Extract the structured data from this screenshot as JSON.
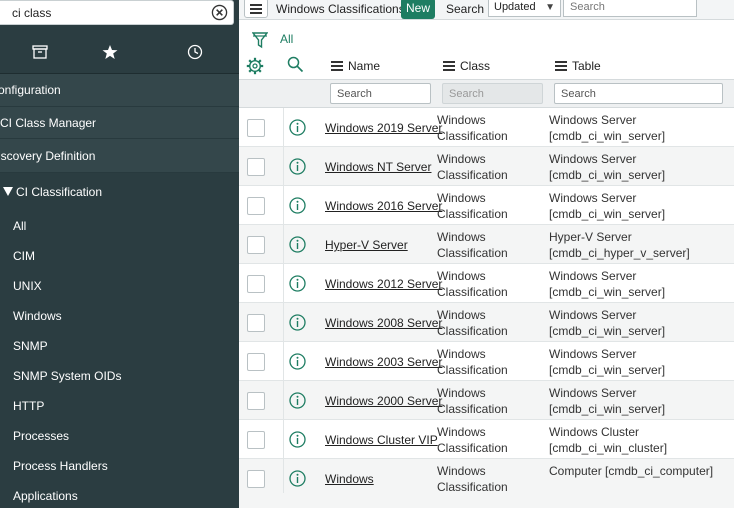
{
  "sidebar": {
    "filter_value": "ci class",
    "tabs": [
      {
        "icon": "archive-icon"
      },
      {
        "icon": "star-icon"
      },
      {
        "icon": "clock-icon"
      }
    ],
    "modules": [
      "onfiguration",
      "CI Class Manager",
      "iscovery Definition"
    ],
    "section": {
      "label": "CI Classification",
      "expanded": true
    },
    "items": [
      "All",
      "CIM",
      "UNIX",
      "Windows",
      "SNMP",
      "SNMP System OIDs",
      "HTTP",
      "Processes",
      "Process Handlers",
      "Applications"
    ]
  },
  "header": {
    "title": "Windows Classifications",
    "new_label": "New",
    "search_label": "Search",
    "sort_value": "Updated",
    "search_placeholder": "Search"
  },
  "filter": {
    "label": "All"
  },
  "columns": [
    "Name",
    "Class",
    "Table"
  ],
  "column_search_placeholders": [
    "Search",
    "Search",
    "Search"
  ],
  "rows": [
    {
      "name": "Windows 2019 Server",
      "class": "Windows Classification",
      "table": "Windows Server [cmdb_ci_win_server]"
    },
    {
      "name": "Windows NT Server",
      "class": "Windows Classification",
      "table": "Windows Server [cmdb_ci_win_server]"
    },
    {
      "name": "Windows 2016 Server",
      "class": "Windows Classification",
      "table": "Windows Server [cmdb_ci_win_server]"
    },
    {
      "name": "Hyper-V Server",
      "class": "Windows Classification",
      "table": "Hyper-V Server [cmdb_ci_hyper_v_server]"
    },
    {
      "name": "Windows 2012 Server",
      "class": "Windows Classification",
      "table": "Windows Server [cmdb_ci_win_server]"
    },
    {
      "name": "Windows 2008 Server",
      "class": "Windows Classification",
      "table": "Windows Server [cmdb_ci_win_server]"
    },
    {
      "name": "Windows 2003 Server",
      "class": "Windows Classification",
      "table": "Windows Server [cmdb_ci_win_server]"
    },
    {
      "name": "Windows 2000 Server",
      "class": "Windows Classification",
      "table": "Windows Server [cmdb_ci_win_server]"
    },
    {
      "name": "Windows Cluster VIP",
      "class": "Windows Classification",
      "table": "Windows Cluster [cmdb_ci_win_cluster]"
    },
    {
      "name": "Windows",
      "class": "Windows Classification",
      "table": "Computer [cmdb_ci_computer]"
    }
  ],
  "colors": {
    "sidebar_bg": "#2b3d41",
    "accent": "#1e7d62",
    "info_icon": "#1e7d62"
  }
}
